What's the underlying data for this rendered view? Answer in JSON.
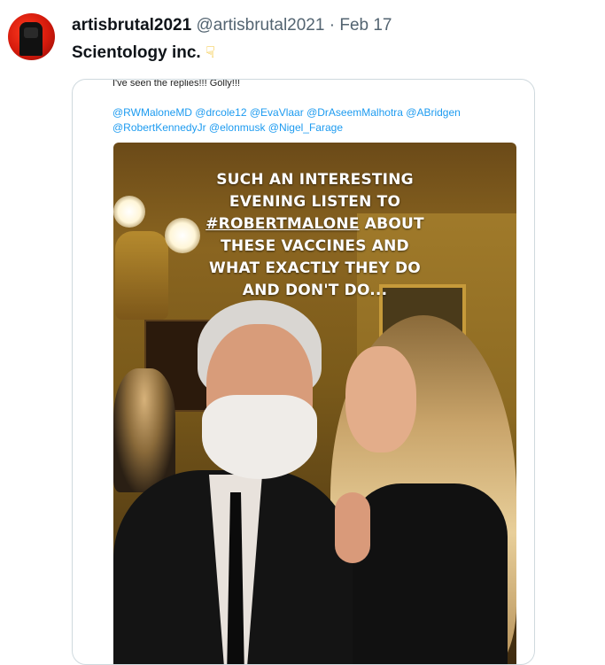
{
  "tweet": {
    "display_name": "artisbrutal2021",
    "handle": "@artisbrutal2021",
    "separator": "·",
    "date": "Feb 17",
    "text": "Scientology inc.",
    "emoji_icon": "backhand-index-pointing-down"
  },
  "quoted_card": {
    "top_text": "I've seen the replies!!! Golly!!!",
    "mentions_line1": "@RWMaloneMD @drcole12 @EvaVlaar @DrAseemMalhotra @ABridgen",
    "mentions_line2": "@RobertKennedyJr @elonmusk @Nigel_Farage",
    "mention_color": "#1d9bf0",
    "image_caption": {
      "line1": "SUCH AN INTERESTING",
      "line2": "EVENING LISTEN TO",
      "line3_hashtag": "#ROBERTMALONE",
      "line3_rest": " ABOUT",
      "line4": "THESE VACCINES AND",
      "line5": "WHAT EXACTLY THEY DO",
      "line6": "AND DON'T DO..."
    }
  }
}
